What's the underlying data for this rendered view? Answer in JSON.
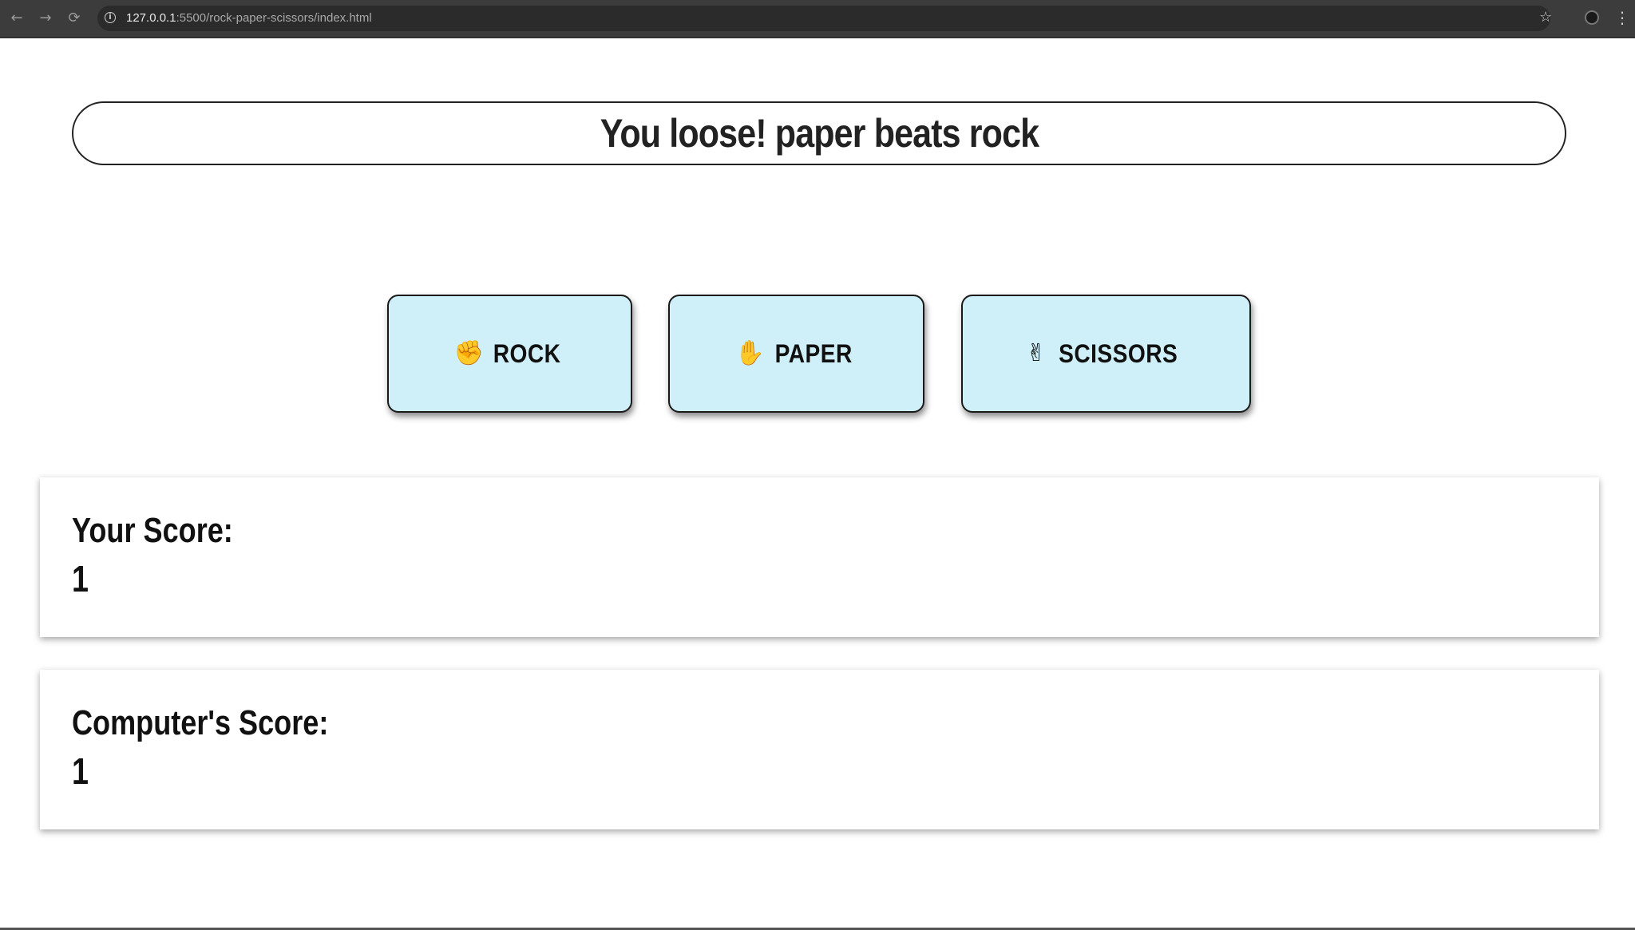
{
  "browser": {
    "nav": {
      "back_icon": "←",
      "forward_icon": "→",
      "reload_icon": "⟳"
    },
    "url_host": "127.0.0.1",
    "url_rest": ":5500/rock-paper-scissors/index.html",
    "star_icon": "☆",
    "menu_icon": "⋮"
  },
  "game": {
    "result_message": "You loose! paper beats rock",
    "choices": [
      {
        "icon_glyph": "✊",
        "icon_name": "fist-icon",
        "label": "ROCK"
      },
      {
        "icon_glyph": "✋",
        "icon_name": "hand-icon",
        "label": "PAPER"
      },
      {
        "icon_glyph": "✌",
        "icon_name": "scissors-hand-icon",
        "label": "SCISSORS"
      }
    ],
    "player_score": {
      "label": "Your Score:",
      "value": "1"
    },
    "computer_score": {
      "label": "Computer's Score:",
      "value": "1"
    }
  },
  "colors": {
    "button_bg": "#cff0f8",
    "chrome_bg": "#3c3c3c",
    "text": "#222222"
  }
}
